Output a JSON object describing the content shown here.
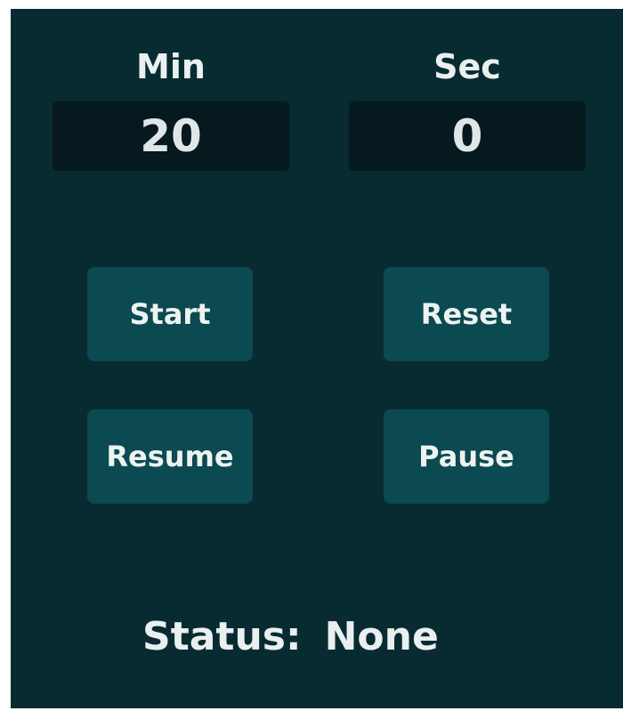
{
  "timer": {
    "min_label": "Min",
    "sec_label": "Sec",
    "min_value": "20",
    "sec_value": "0"
  },
  "buttons": {
    "start": "Start",
    "reset": "Reset",
    "resume": "Resume",
    "pause": "Pause"
  },
  "status": {
    "label": "Status:",
    "value": "None"
  },
  "colors": {
    "panel_bg": "#082b31",
    "field_bg": "#05191e",
    "button_bg": "#0b4a51",
    "text": "#eaf0ef"
  }
}
